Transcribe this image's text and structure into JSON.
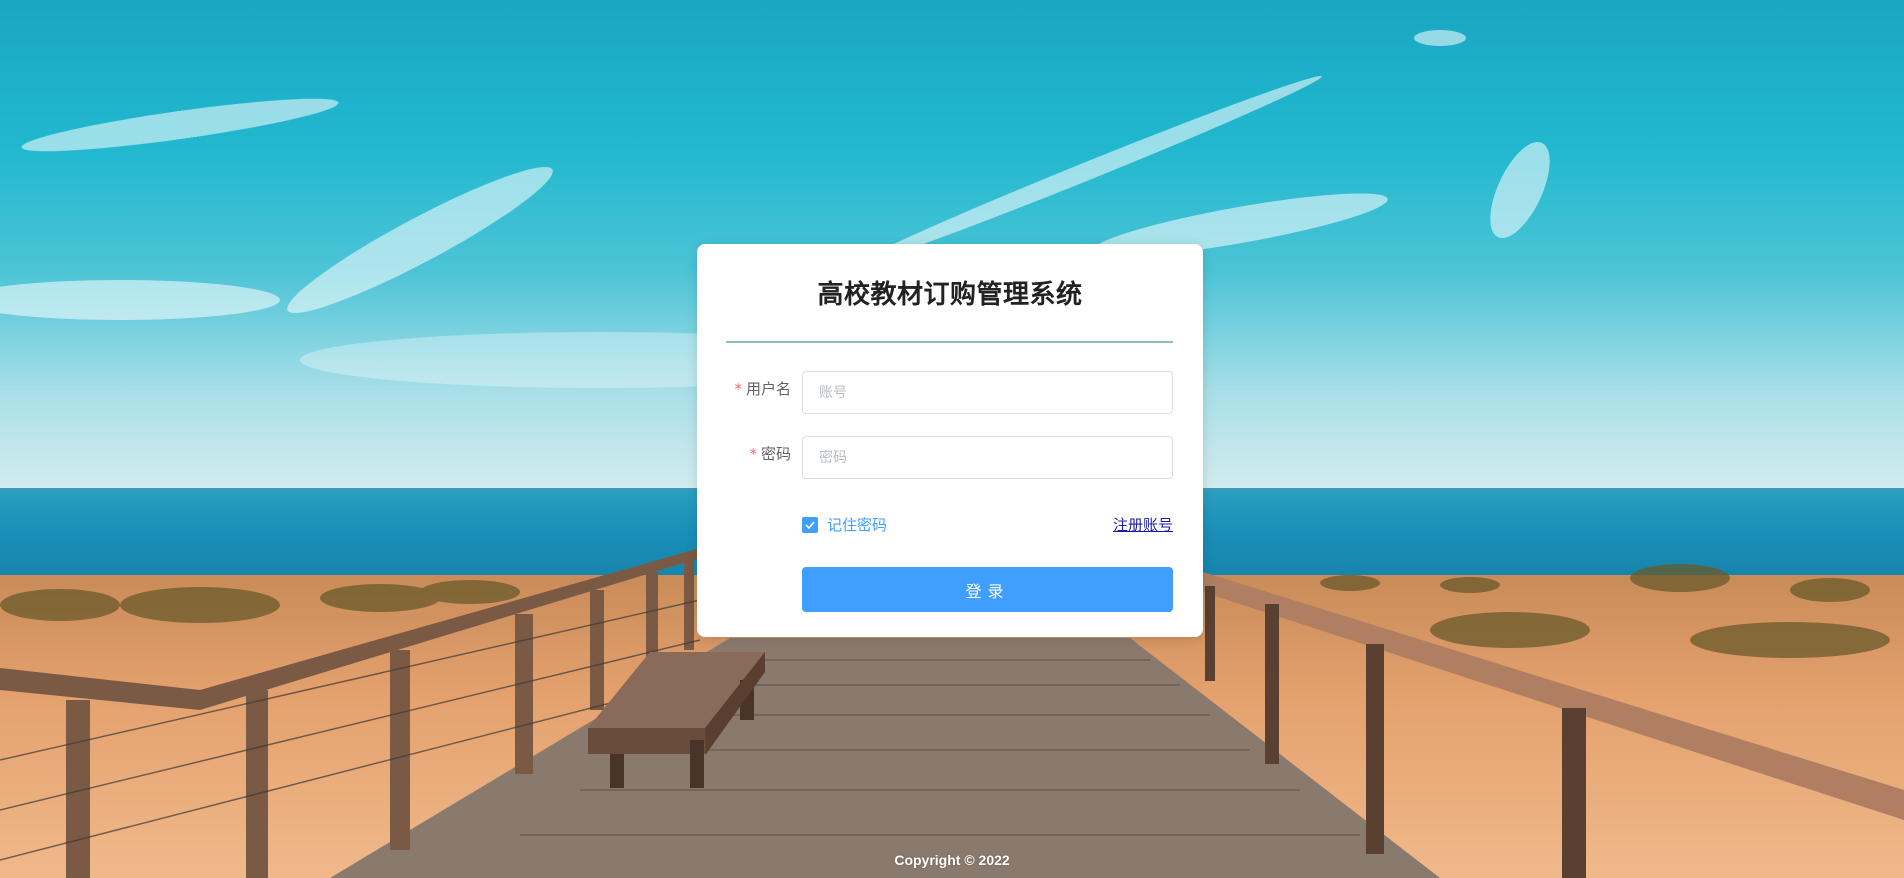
{
  "app": {
    "title": "高校教材订购管理系统"
  },
  "login_form": {
    "username": {
      "label": "用户名",
      "required_mark": "*",
      "value": "",
      "placeholder": "账号"
    },
    "password": {
      "label": "密码",
      "required_mark": "*",
      "value": "",
      "placeholder": "密码"
    },
    "remember": {
      "label": "记住密码",
      "checked": true
    },
    "register_link": "注册账号",
    "submit_label": "登录"
  },
  "footer": {
    "copyright": "Copyright © 2022"
  },
  "icons": {
    "checkbox": "checkmark-icon"
  },
  "colors": {
    "primary": "#409eff",
    "required": "#f56c6c",
    "link": "#1a1aa8",
    "divider": "#8fbdc0"
  }
}
